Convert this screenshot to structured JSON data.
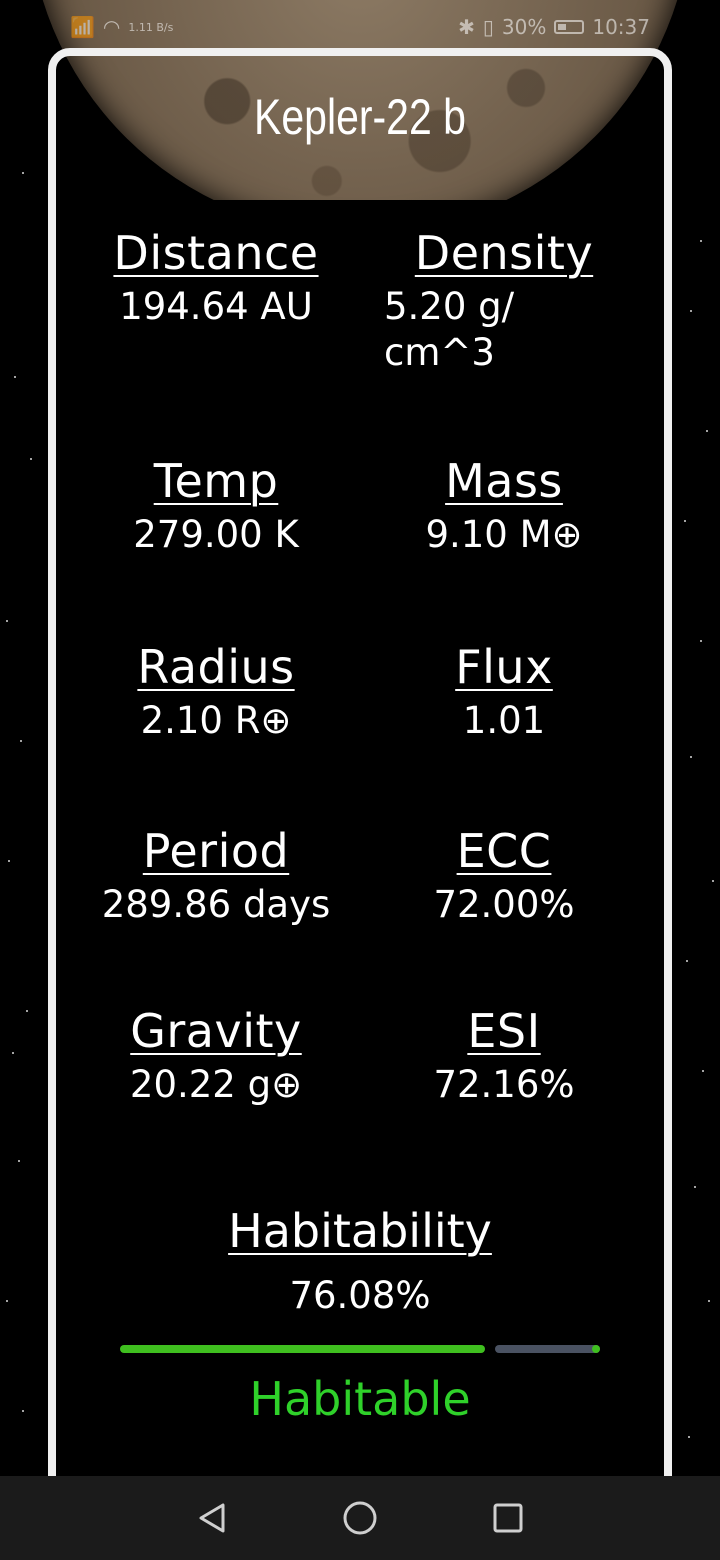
{
  "status_bar": {
    "network_speed": "1.11\nB/s",
    "battery_percent": "30%",
    "time": "10:37"
  },
  "planet": {
    "name": "Kepler-22 b"
  },
  "stats": [
    {
      "key": "distance",
      "label": "Distance",
      "value": "194.64 AU"
    },
    {
      "key": "density",
      "label": "Density",
      "value": "5.20 g/ cm^3"
    },
    {
      "key": "temp",
      "label": "Temp",
      "value": "279.00 K"
    },
    {
      "key": "mass",
      "label": "Mass",
      "value": "9.10 M⊕"
    },
    {
      "key": "radius",
      "label": "Radius",
      "value": "2.10 R⊕"
    },
    {
      "key": "flux",
      "label": "Flux",
      "value": "1.01"
    },
    {
      "key": "period",
      "label": "Period",
      "value": "289.86 days"
    },
    {
      "key": "ecc",
      "label": "ECC",
      "value": "72.00%"
    },
    {
      "key": "gravity",
      "label": "Gravity",
      "value": "20.22 g⊕"
    },
    {
      "key": "esi",
      "label": "ESI",
      "value": "72.16%"
    }
  ],
  "habitability": {
    "label": "Habitability",
    "value": "76.08%",
    "progress_fraction": 0.7608,
    "verdict": "Habitable",
    "verdict_color": "#2fd12a",
    "bar_color": "#3fbf1f",
    "track_color": "#4a5262"
  },
  "nav": {
    "back_icon": "triangle-back-icon",
    "home_icon": "circle-home-icon",
    "recents_icon": "square-recents-icon"
  }
}
